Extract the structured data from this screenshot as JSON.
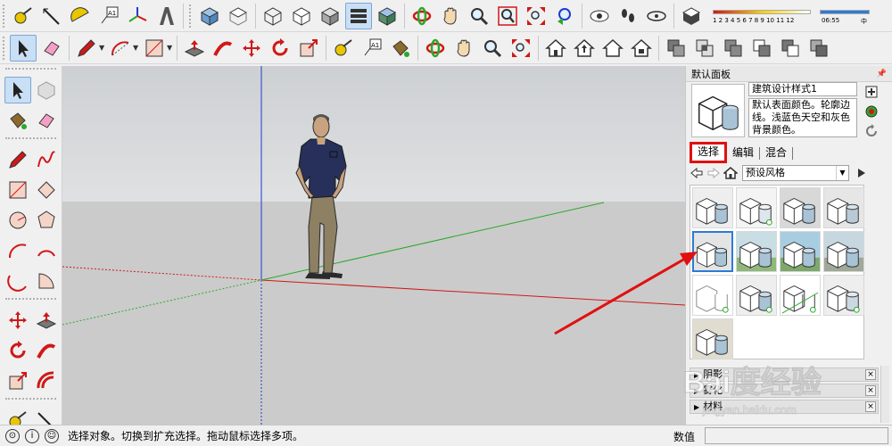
{
  "panel": {
    "title": "默认面板",
    "style_name": "建筑设计样式1",
    "style_description": "默认表面颜色。轮廓边线。浅蓝色天空和灰色背景颜色。",
    "tabs": [
      {
        "label": "选择",
        "active": true
      },
      {
        "label": "编辑",
        "active": false
      },
      {
        "label": "混合",
        "active": false
      }
    ],
    "library_select": "预设风格",
    "sections": [
      {
        "label": "阴影"
      },
      {
        "label": "雾化"
      },
      {
        "label": "材料"
      }
    ]
  },
  "toolbar": {
    "shadow_scale": "1 2 3 4 5 6 7 8 9 10 11 12",
    "shadow_time": "06:55",
    "shadow_time_suffix": "中",
    "text_tool_label": "A1"
  },
  "status": {
    "text": "选择对象。切换到扩充选择。拖动鼠标选择多项。",
    "measure_label": "数值",
    "measure_value": ""
  },
  "watermark": {
    "brand": "Bai度经验",
    "url": "jingyan.baidu.com"
  },
  "colors": {
    "sky": "#d3d6d8",
    "ground": "#cbcbcb",
    "axis_blue": "#1e3ad0",
    "axis_red": "#d01818",
    "axis_green": "#2aa82a",
    "highlight_red": "#e01010",
    "selection_blue": "#2c7bd6"
  }
}
